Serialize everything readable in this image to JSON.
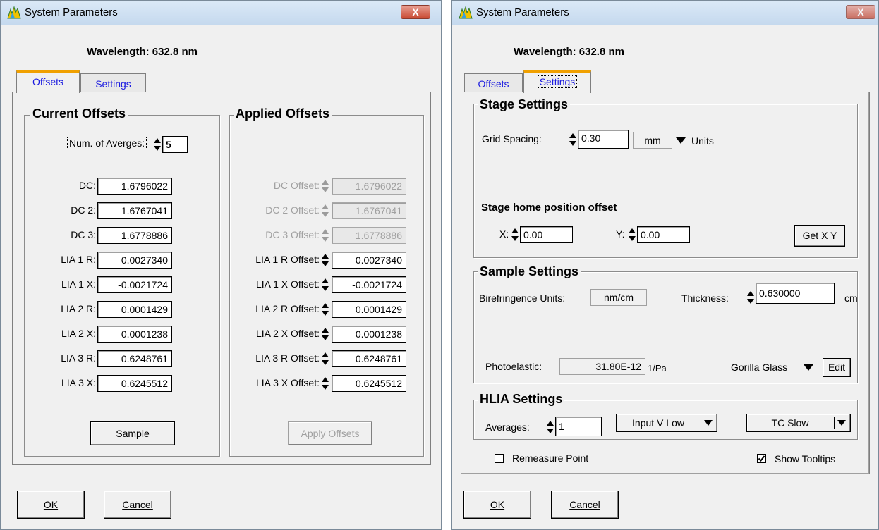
{
  "left_window": {
    "title": "System Parameters",
    "close_label": "X",
    "wavelength": "Wavelength:  632.8 nm",
    "tabs": {
      "offsets": "Offsets",
      "settings": "Settings"
    },
    "current_offsets": {
      "title": "Current Offsets",
      "num_averages_label": "Num. of Averges:",
      "num_averages_value": "5",
      "rows": [
        {
          "label": "DC:",
          "value": "1.6796022"
        },
        {
          "label": "DC 2:",
          "value": "1.6767041"
        },
        {
          "label": "DC 3:",
          "value": "1.6778886"
        },
        {
          "label": "LIA 1 R:",
          "value": "0.0027340"
        },
        {
          "label": "LIA 1 X:",
          "value": "-0.0021724"
        },
        {
          "label": "LIA 2 R:",
          "value": "0.0001429"
        },
        {
          "label": "LIA 2 X:",
          "value": "0.0001238"
        },
        {
          "label": "LIA 3 R:",
          "value": "0.6248761"
        },
        {
          "label": "LIA 3 X:",
          "value": "0.6245512"
        }
      ],
      "sample_button": "Sample"
    },
    "applied_offsets": {
      "title": "Applied Offsets",
      "rows": [
        {
          "label": "DC Offset:",
          "value": "1.6796022"
        },
        {
          "label": "DC 2 Offset:",
          "value": "1.6767041"
        },
        {
          "label": "DC 3 Offset:",
          "value": "1.6778886"
        },
        {
          "label": "LIA 1 R Offset:",
          "value": "0.0027340"
        },
        {
          "label": "LIA 1 X Offset:",
          "value": "-0.0021724"
        },
        {
          "label": "LIA 2 R Offset:",
          "value": "0.0001429"
        },
        {
          "label": "LIA 2 X Offset:",
          "value": "0.0001238"
        },
        {
          "label": "LIA 3 R Offset:",
          "value": "0.6248761"
        },
        {
          "label": "LIA 3 X Offset:",
          "value": "0.6245512"
        }
      ],
      "apply_button": "Apply Offsets"
    },
    "ok_button": "OK",
    "cancel_button": "Cancel"
  },
  "right_window": {
    "title": "System Parameters",
    "close_label": "X",
    "wavelength": "Wavelength:  632.8 nm",
    "tabs": {
      "offsets": "Offsets",
      "settings": "Settings"
    },
    "stage_settings": {
      "title": "Stage Settings",
      "grid_spacing_label": "Grid Spacing:",
      "grid_spacing_value": "0.30",
      "units_value": "mm",
      "units_label": "Units",
      "home_offset_title": "Stage home position offset",
      "x_label": "X:",
      "x_value": "0.00",
      "y_label": "Y:",
      "y_value": "0.00",
      "get_xy_button": "Get X Y"
    },
    "sample_settings": {
      "title": "Sample Settings",
      "birefringence_label": "Birefringence Units:",
      "birefringence_value": "nm/cm",
      "thickness_label": "Thickness:",
      "thickness_value": "0.630000",
      "thickness_unit": "cm",
      "photoelastic_label": "Photoelastic:",
      "photoelastic_value": "31.80E-12",
      "photoelastic_unit": "1/Pa",
      "material_value": "Gorilla Glass",
      "edit_button": "Edit"
    },
    "hlia_settings": {
      "title": "HLIA Settings",
      "averages_label": "Averages:",
      "averages_value": "1",
      "input_select": "Input V Low",
      "tc_select": "TC Slow"
    },
    "remeasure_label": "Remeasure Point",
    "remeasure_checked": false,
    "tooltips_label": "Show Tooltips",
    "tooltips_checked": true,
    "ok_button": "OK",
    "cancel_button": "Cancel"
  }
}
